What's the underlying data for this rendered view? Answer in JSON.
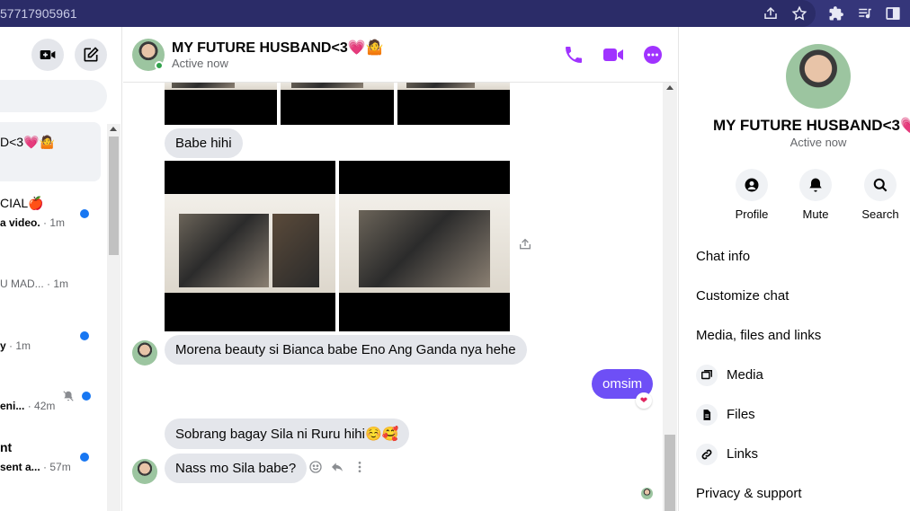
{
  "browser": {
    "url_fragment": "57717905961",
    "icons": [
      "share-icon",
      "star-icon",
      "extensions-icon",
      "media-queue-icon",
      "side-panel-icon"
    ]
  },
  "sidebar": {
    "buttons": [
      "new-video-call-icon",
      "compose-icon"
    ],
    "conversations": [
      {
        "name": "D<3💗🤷",
        "snippet": "",
        "time": "",
        "unread": false,
        "active": true
      },
      {
        "name": "CIAL🍎",
        "snippet": "a video.",
        "time": "· 1m",
        "unread": true,
        "active": false
      },
      {
        "name": "",
        "snippet": "U MAD...",
        "time": "· 1m",
        "unread": false,
        "active": false
      },
      {
        "name": "",
        "snippet": "y",
        "time": "· 1m",
        "unread": true,
        "active": false
      },
      {
        "name": "",
        "snippet": "eni...",
        "time": "· 42m",
        "unread": true,
        "muted": true,
        "active": false
      },
      {
        "name": "nt",
        "snippet": "sent a...",
        "time": "· 57m",
        "unread": true,
        "active": false
      }
    ]
  },
  "chat": {
    "contact_name": "MY FUTURE HUSBAND<3💗🤷",
    "status": "Active now",
    "header_icons": [
      "phone-icon",
      "video-camera-icon",
      "more-options-icon"
    ],
    "messages": [
      {
        "sender": "them",
        "text": "Babe hihi"
      },
      {
        "sender": "them",
        "text": "Morena beauty si Bianca babe Eno Ang Ganda nya hehe"
      },
      {
        "sender": "me",
        "text": "omsim",
        "reaction": "❤"
      },
      {
        "sender": "them",
        "text": "Sobrang bagay Sila ni Ruru hihi☺️🥰"
      },
      {
        "sender": "them",
        "text": "Nass mo Sila babe?"
      }
    ],
    "message_action_icons": [
      "react-icon",
      "reply-icon",
      "more-icon"
    ]
  },
  "details": {
    "name": "MY FUTURE HUSBAND<3💗🤷",
    "status": "Active now",
    "actions": [
      {
        "label": "Profile",
        "icon": "profile-icon"
      },
      {
        "label": "Mute",
        "icon": "bell-icon"
      },
      {
        "label": "Search",
        "icon": "search-icon"
      }
    ],
    "sections": [
      "Chat info",
      "Customize chat",
      "Media, files and links"
    ],
    "media_items": [
      {
        "label": "Media",
        "icon": "media-icon"
      },
      {
        "label": "Files",
        "icon": "file-icon"
      },
      {
        "label": "Links",
        "icon": "link-icon"
      }
    ],
    "privacy": "Privacy & support"
  },
  "colors": {
    "accent": "#a033ff",
    "my_bubble": "#6e4ff6",
    "browser_bar": "#35367a",
    "unread_dot": "#1877f2"
  }
}
